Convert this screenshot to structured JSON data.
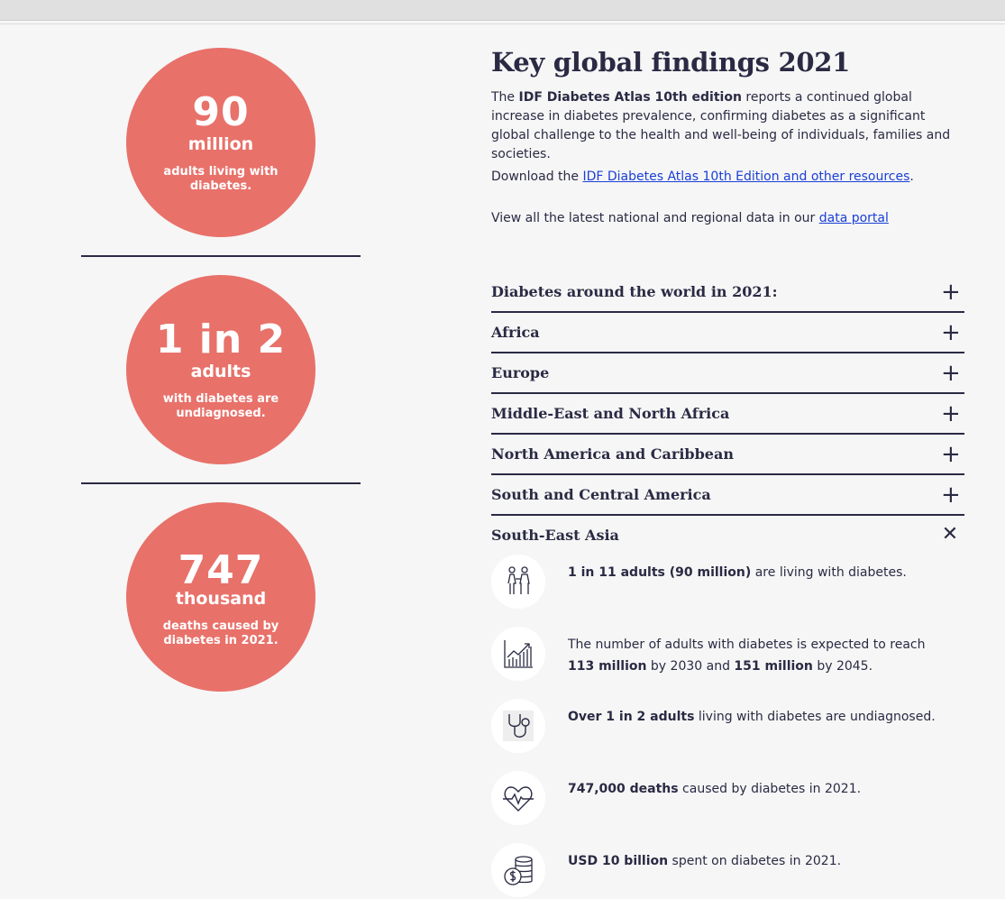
{
  "stats": [
    {
      "big": "90",
      "unit": "million",
      "desc": "adults living with diabetes."
    },
    {
      "big": "1 in 2",
      "unit": "adults",
      "desc": "with diabetes are undiagnosed."
    },
    {
      "big": "747",
      "unit": "thousand",
      "desc": "deaths caused by diabetes in 2021."
    }
  ],
  "header": {
    "title": "Key global findings 2021"
  },
  "intro": {
    "p1_pre": "The ",
    "p1_bold": "IDF Diabetes Atlas 10th edition",
    "p1_post": " reports a continued global increase in diabetes prevalence, confirming diabetes as a significant global challenge to the health and well-being of individuals, families and societies.",
    "p2_pre": "Download the ",
    "p2_link": "IDF Diabetes Atlas 10th Edition and other resources",
    "p2_post": ".",
    "p3_pre": "View all the latest national and regional data in our ",
    "p3_link": "data portal"
  },
  "accordion": {
    "items": [
      {
        "label": "Diabetes around the world in 2021:",
        "toggle": "+"
      },
      {
        "label": "Africa",
        "toggle": "+"
      },
      {
        "label": "Europe",
        "toggle": "+"
      },
      {
        "label": "Middle-East and North Africa",
        "toggle": "+"
      },
      {
        "label": "North America and Caribbean",
        "toggle": "+"
      },
      {
        "label": "South and Central America",
        "toggle": "+"
      }
    ],
    "open": {
      "label": "South-East Asia",
      "toggle": "✕"
    }
  },
  "findings": [
    {
      "icon": "people-icon",
      "parts": [
        {
          "b": "1 in 11 adults (90 million)"
        },
        {
          "t": " are living with diabetes."
        }
      ]
    },
    {
      "icon": "chart-growth-icon",
      "parts": [
        {
          "t": "The number of adults with diabetes is expected to reach "
        },
        {
          "b": "113 million"
        },
        {
          "t": " by 2030 and "
        },
        {
          "b": "151 million"
        },
        {
          "t": " by 2045."
        }
      ]
    },
    {
      "icon": "stethoscope-icon",
      "parts": [
        {
          "b": "Over 1 in 2 adults"
        },
        {
          "t": " living with diabetes are undiagnosed."
        }
      ]
    },
    {
      "icon": "heartbeat-icon",
      "parts": [
        {
          "b": "747,000 deaths"
        },
        {
          "t": " caused by diabetes in 2021."
        }
      ]
    },
    {
      "icon": "coins-icon",
      "parts": [
        {
          "b": "USD 10 billion"
        },
        {
          "t": " spent on diabetes in 2021."
        }
      ]
    }
  ],
  "colors": {
    "accent": "#e8716a",
    "text": "#2a2a44",
    "link": "#1a3fd6",
    "background": "#f6f6f6"
  }
}
